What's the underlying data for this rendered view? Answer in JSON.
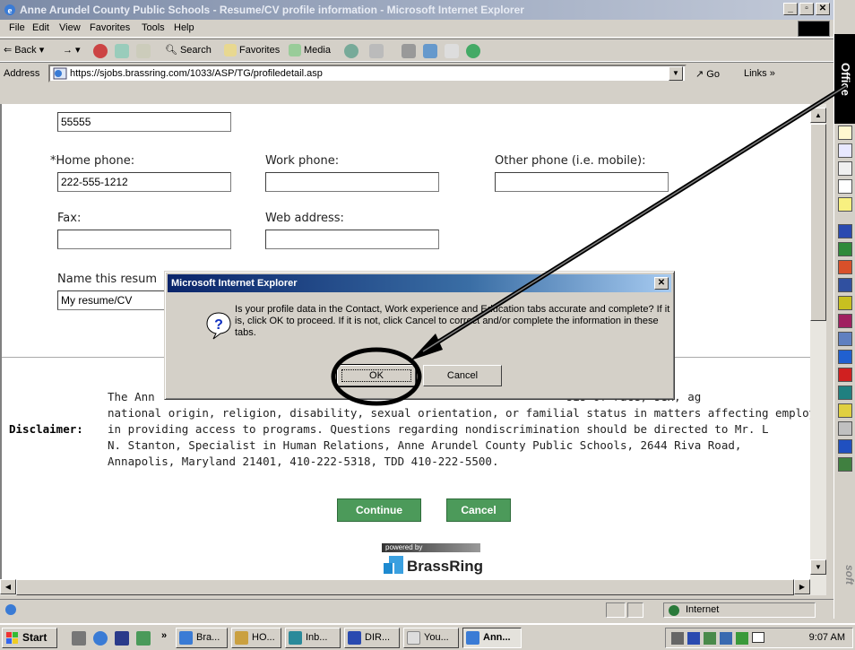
{
  "window": {
    "title": "Anne Arundel County Public Schools - Resume/CV profile information - Microsoft Internet Explorer",
    "minimize": "_",
    "maximize": "▫",
    "close": "✕"
  },
  "menu": [
    "File",
    "Edit",
    "View",
    "Favorites",
    "Tools",
    "Help"
  ],
  "toolbar": {
    "back": "Back",
    "search": "Search",
    "favorites": "Favorites",
    "media": "Media"
  },
  "address": {
    "label": "Address",
    "url": "https://sjobs.brassring.com/1033/ASP/TG/profiledetail.asp",
    "go": "Go",
    "links": "Links"
  },
  "form": {
    "zip_value": "55555",
    "home_phone_label": "*Home phone:",
    "home_phone_value": "222-555-1212",
    "work_phone_label": "Work phone:",
    "work_phone_value": "",
    "other_phone_label": "Other phone (i.e. mobile):",
    "other_phone_value": "",
    "fax_label": "Fax:",
    "fax_value": "",
    "web_label": "Web address:",
    "web_value": "",
    "resume_name_label": "Name this resum",
    "resume_name_value": "My resume/CV"
  },
  "disclaimer": {
    "label": "Disclaimer:",
    "line1": "The Ann                                                             sis of race, sex, ag",
    "line2": "national origin, religion, disability, sexual orientation, or familial status in matters affecting employn",
    "line3": "in providing access to programs. Questions regarding nondiscrimination should be directed to Mr. L",
    "line4": "N. Stanton, Specialist in Human Relations, Anne Arundel County Public Schools, 2644 Riva Road,",
    "line5": "Annapolis, Maryland 21401, 410-222-5318, TDD 410-222-5500."
  },
  "actions": {
    "continue": "Continue",
    "cancel": "Cancel"
  },
  "branding": {
    "powered_by": "powered by",
    "brand": "BrassRing"
  },
  "dialog": {
    "title": "Microsoft Internet Explorer",
    "close": "✕",
    "message": "Is your profile data in the Contact, Work experience and Education tabs accurate and complete? If it is, click OK to proceed. If it is not, click Cancel to correct and/or complete the information in these tabs.",
    "ok": "OK",
    "cancel": "Cancel"
  },
  "office_bar": {
    "top": "Office",
    "bottom": "soft"
  },
  "status": {
    "zone": "Internet"
  },
  "taskbar": {
    "start": "Start",
    "chevron": "»",
    "tasks": [
      "Bra...",
      "HO...",
      "Inb...",
      "DIR...",
      "You...",
      "Ann..."
    ],
    "clock": "9:07 AM"
  },
  "colors": {
    "accent_green": "#4c9a5a",
    "dialog_title": "#0a246a",
    "annotation": "#000000"
  }
}
